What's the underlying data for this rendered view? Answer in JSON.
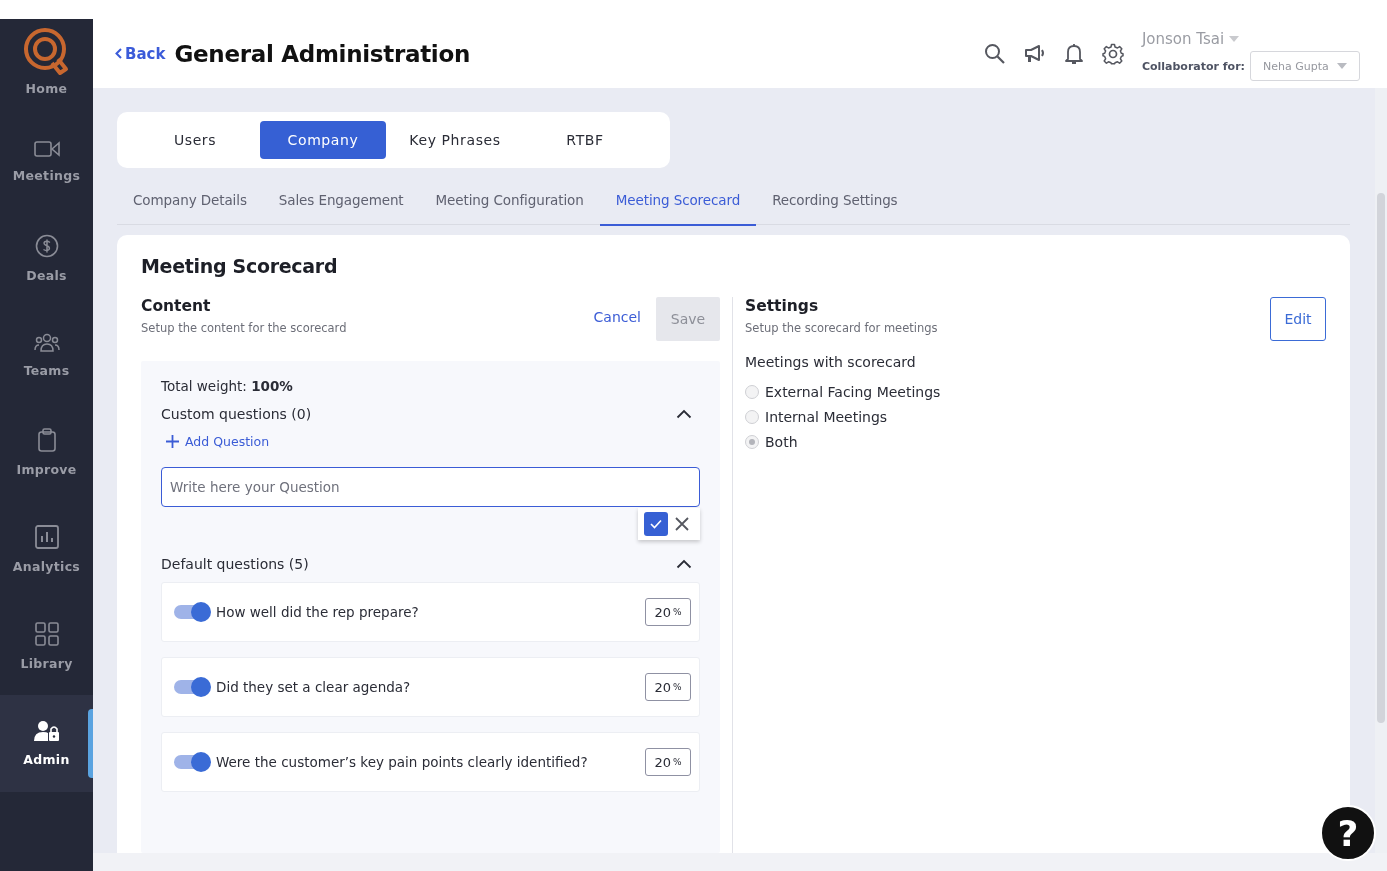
{
  "sidebar": {
    "items": [
      {
        "label": "Home",
        "kind": "logo",
        "selected": false
      },
      {
        "label": "Meetings",
        "kind": "video",
        "selected": false
      },
      {
        "label": "Deals",
        "kind": "dollar",
        "selected": false
      },
      {
        "label": "Teams",
        "kind": "people",
        "selected": false
      },
      {
        "label": "Improve",
        "kind": "clipboard",
        "selected": false
      },
      {
        "label": "Analytics",
        "kind": "chart",
        "selected": false
      },
      {
        "label": "Library",
        "kind": "grid",
        "selected": false
      },
      {
        "label": "Admin",
        "kind": "admin",
        "selected": true
      }
    ]
  },
  "header": {
    "back": "Back",
    "title": "General Administration",
    "user": "Jonson Tsai",
    "collaborator_label": "Collaborator for:",
    "collaborator_value": "Neha Gupta"
  },
  "tabs": [
    {
      "label": "Users",
      "selected": false
    },
    {
      "label": "Company",
      "selected": true
    },
    {
      "label": "Key Phrases",
      "selected": false
    },
    {
      "label": "RTBF",
      "selected": false
    }
  ],
  "subtabs": [
    {
      "label": "Company Details",
      "selected": false
    },
    {
      "label": "Sales Engagement",
      "selected": false
    },
    {
      "label": "Meeting Configuration",
      "selected": false
    },
    {
      "label": "Meeting Scorecard",
      "selected": true
    },
    {
      "label": "Recording Settings",
      "selected": false
    }
  ],
  "card": {
    "title": "Meeting Scorecard",
    "content": {
      "title": "Content",
      "subtitle": "Setup the content for the scorecard",
      "cancel": "Cancel",
      "save": {
        "label": "Save",
        "disabled": true
      },
      "total_weight": "Total weight: **100%**",
      "custom": {
        "title": "Custom questions (0)",
        "expanded": true,
        "add": "Add Question",
        "placeholder": "Write here your Question"
      },
      "default": {
        "title": "Default questions (5)",
        "expanded": true,
        "questions": [
          {
            "text": "How well did the rep prepare?",
            "on": true,
            "weight": "20",
            "unit": "%"
          },
          {
            "text": "Did they set a clear agenda?",
            "on": true,
            "weight": "20",
            "unit": "%"
          },
          {
            "text": "Were the customer’s key pain points clearly identified?",
            "on": true,
            "weight": "20",
            "unit": "%"
          }
        ]
      }
    },
    "settings": {
      "title": "Settings",
      "subtitle": "Setup the scorecard for meetings",
      "edit": "Edit",
      "label": "Meetings with scorecard",
      "disabled": true,
      "options": [
        {
          "label": "External Facing Meetings",
          "selected": false
        },
        {
          "label": "Internal Meetings",
          "selected": false
        },
        {
          "label": "Both",
          "selected": true
        }
      ]
    }
  },
  "help": "?"
}
